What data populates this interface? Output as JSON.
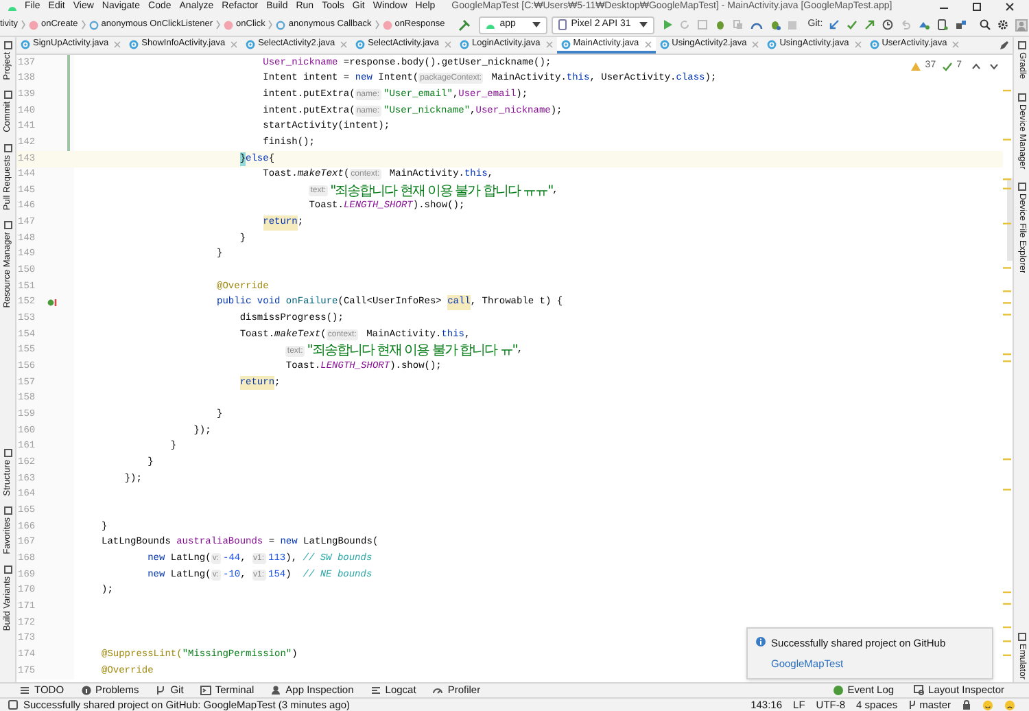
{
  "window": {
    "title": "GoogleMapTest [C:₩Users₩5-11₩Desktop₩GoogleMapTest] - MainActivity.java [GoogleMapTest.app]"
  },
  "menu": [
    "File",
    "Edit",
    "View",
    "Navigate",
    "Code",
    "Analyze",
    "Refactor",
    "Build",
    "Run",
    "Tools",
    "Git",
    "Window",
    "Help"
  ],
  "breadcrumbs": [
    {
      "label": "tivity",
      "kind": "plain"
    },
    {
      "label": "onCreate",
      "kind": "method"
    },
    {
      "label": "anonymous OnClickListener",
      "kind": "anonymous"
    },
    {
      "label": "onClick",
      "kind": "method"
    },
    {
      "label": "anonymous Callback",
      "kind": "anonymous"
    },
    {
      "label": "onResponse",
      "kind": "method"
    }
  ],
  "run_config": "app",
  "device": "Pixel 2 API 31",
  "git_label": "Git:",
  "left_tools": [
    "Project",
    "Commit",
    "Pull Requests",
    "Resource Manager",
    "Structure",
    "Favorites",
    "Build Variants"
  ],
  "right_tools": [
    "Gradle",
    "Device Manager",
    "Device File Explorer",
    "Emulator"
  ],
  "tabs": [
    {
      "label": "SignUpActivity.java",
      "selected": false
    },
    {
      "label": "ShowInfoActivity.java",
      "selected": false
    },
    {
      "label": "SelectActivity2.java",
      "selected": false
    },
    {
      "label": "SelectActivity.java",
      "selected": false
    },
    {
      "label": "LoginActivity.java",
      "selected": false
    },
    {
      "label": "MainActivity.java",
      "selected": true
    },
    {
      "label": "UsingActivity2.java",
      "selected": false
    },
    {
      "label": "UsingActivity.java",
      "selected": false
    },
    {
      "label": "UserActivity.java",
      "selected": false
    }
  ],
  "inspections": {
    "warnings": "37",
    "weak_warnings": "7"
  },
  "lines": [
    {
      "number": "137",
      "current": false,
      "modified": true,
      "overrides": false,
      "tokens": [
        {
          "kind": "field",
          "text": "                            User_nickname"
        },
        {
          "kind": "plain",
          "text": " =response.body().getUser_nickname();"
        }
      ]
    },
    {
      "number": "138",
      "current": false,
      "modified": true,
      "overrides": false,
      "tokens": [
        {
          "kind": "plain",
          "text": "                            Intent intent = "
        },
        {
          "kind": "kw",
          "text": "new"
        },
        {
          "kind": "plain",
          "text": " Intent("
        },
        {
          "kind": "hint",
          "text": "packageContext:"
        },
        {
          "kind": "plain",
          "text": " MainActivity."
        },
        {
          "kind": "kw",
          "text": "this"
        },
        {
          "kind": "plain",
          "text": ", UserActivity."
        },
        {
          "kind": "kw",
          "text": "class"
        },
        {
          "kind": "plain",
          "text": ");"
        }
      ]
    },
    {
      "number": "139",
      "current": false,
      "modified": true,
      "overrides": false,
      "tokens": [
        {
          "kind": "plain",
          "text": "                            intent.putExtra("
        },
        {
          "kind": "hint",
          "text": "name:"
        },
        {
          "kind": "str",
          "text": "\"User_email\""
        },
        {
          "kind": "plain",
          "text": ","
        },
        {
          "kind": "field",
          "text": "User_email"
        },
        {
          "kind": "plain",
          "text": ");"
        }
      ]
    },
    {
      "number": "140",
      "current": false,
      "modified": true,
      "overrides": false,
      "tokens": [
        {
          "kind": "plain",
          "text": "                            intent.putExtra("
        },
        {
          "kind": "hint",
          "text": "name:"
        },
        {
          "kind": "str",
          "text": "\"User_nickname\""
        },
        {
          "kind": "plain",
          "text": ","
        },
        {
          "kind": "field",
          "text": "User_nickname"
        },
        {
          "kind": "plain",
          "text": ");"
        }
      ]
    },
    {
      "number": "141",
      "current": false,
      "modified": true,
      "overrides": false,
      "tokens": [
        {
          "kind": "plain",
          "text": "                            startActivity(intent);"
        }
      ]
    },
    {
      "number": "142",
      "current": false,
      "modified": true,
      "overrides": false,
      "tokens": [
        {
          "kind": "plain",
          "text": "                            finish();"
        }
      ]
    },
    {
      "number": "143",
      "current": true,
      "modified": false,
      "overrides": false,
      "tokens": [
        {
          "kind": "brace",
          "text": "                        }"
        },
        {
          "kind": "kw",
          "text": "else"
        },
        {
          "kind": "plain",
          "text": "{"
        }
      ]
    },
    {
      "number": "144",
      "current": false,
      "modified": false,
      "overrides": false,
      "tokens": [
        {
          "kind": "plain",
          "text": "                            Toast."
        },
        {
          "kind": "method",
          "text": "makeText"
        },
        {
          "kind": "plain",
          "text": "("
        },
        {
          "kind": "hint",
          "text": "context:"
        },
        {
          "kind": "plain",
          "text": " MainActivity."
        },
        {
          "kind": "kw",
          "text": "this"
        },
        {
          "kind": "plain",
          "text": ","
        }
      ]
    },
    {
      "number": "145",
      "current": false,
      "modified": false,
      "overrides": false,
      "tokens": [
        {
          "kind": "hint",
          "text": "                                    text:"
        },
        {
          "kind": "str",
          "text": "\"죄송합니다 현재 이용 불가 합니다 ㅠㅠ\""
        },
        {
          "kind": "plain",
          "text": ","
        }
      ]
    },
    {
      "number": "146",
      "current": false,
      "modified": false,
      "overrides": false,
      "tokens": [
        {
          "kind": "plain",
          "text": "                                    Toast."
        },
        {
          "kind": "static",
          "text": "LENGTH_SHORT"
        },
        {
          "kind": "plain",
          "text": ").show();"
        }
      ]
    },
    {
      "number": "147",
      "current": false,
      "modified": false,
      "overrides": false,
      "tokens": [
        {
          "kind": "usage",
          "text": "                            return"
        },
        {
          "kind": "plain",
          "text": ";"
        }
      ]
    },
    {
      "number": "148",
      "current": false,
      "modified": false,
      "overrides": false,
      "tokens": [
        {
          "kind": "plain",
          "text": "                        }"
        }
      ]
    },
    {
      "number": "149",
      "current": false,
      "modified": false,
      "overrides": false,
      "tokens": [
        {
          "kind": "plain",
          "text": "                    }"
        }
      ]
    },
    {
      "number": "150",
      "current": false,
      "modified": false,
      "overrides": false
    },
    {
      "number": "151",
      "current": false,
      "modified": false,
      "overrides": false,
      "tokens": [
        {
          "kind": "annot",
          "text": "                    @Override"
        }
      ]
    },
    {
      "number": "152",
      "current": false,
      "modified": false,
      "overrides": true,
      "tokens": [
        {
          "kind": "kw",
          "text": "                    public void"
        },
        {
          "kind": "decl",
          "text": " onFailure"
        },
        {
          "kind": "plain",
          "text": "(Call<UserInfoRes> "
        },
        {
          "kind": "usage",
          "text": "call"
        },
        {
          "kind": "plain",
          "text": ", Throwable t) {"
        }
      ]
    },
    {
      "number": "153",
      "current": false,
      "modified": false,
      "overrides": false,
      "tokens": [
        {
          "kind": "plain",
          "text": "                        dismissProgress();"
        }
      ]
    },
    {
      "number": "154",
      "current": false,
      "modified": false,
      "overrides": false,
      "tokens": [
        {
          "kind": "plain",
          "text": "                        Toast."
        },
        {
          "kind": "method",
          "text": "makeText"
        },
        {
          "kind": "plain",
          "text": "("
        },
        {
          "kind": "hint",
          "text": "context:"
        },
        {
          "kind": "plain",
          "text": " MainActivity."
        },
        {
          "kind": "kw",
          "text": "this"
        },
        {
          "kind": "plain",
          "text": ","
        }
      ]
    },
    {
      "number": "155",
      "current": false,
      "modified": false,
      "overrides": false,
      "tokens": [
        {
          "kind": "hint",
          "text": "                                text:"
        },
        {
          "kind": "str",
          "text": "\"죄송합니다 현재 이용 불가 합니다 ㅠ\""
        },
        {
          "kind": "plain",
          "text": ","
        }
      ]
    },
    {
      "number": "156",
      "current": false,
      "modified": false,
      "overrides": false,
      "tokens": [
        {
          "kind": "plain",
          "text": "                                Toast."
        },
        {
          "kind": "static",
          "text": "LENGTH_SHORT"
        },
        {
          "kind": "plain",
          "text": ").show();"
        }
      ]
    },
    {
      "number": "157",
      "current": false,
      "modified": false,
      "overrides": false,
      "tokens": [
        {
          "kind": "usage",
          "text": "                        return"
        },
        {
          "kind": "plain",
          "text": ";"
        }
      ]
    },
    {
      "number": "158",
      "current": false,
      "modified": false,
      "overrides": false
    },
    {
      "number": "159",
      "current": false,
      "modified": false,
      "overrides": false,
      "tokens": [
        {
          "kind": "plain",
          "text": "                    }"
        }
      ]
    },
    {
      "number": "160",
      "current": false,
      "modified": false,
      "overrides": false,
      "tokens": [
        {
          "kind": "plain",
          "text": "                });"
        }
      ]
    },
    {
      "number": "161",
      "current": false,
      "modified": false,
      "overrides": false,
      "tokens": [
        {
          "kind": "plain",
          "text": "            }"
        }
      ]
    },
    {
      "number": "162",
      "current": false,
      "modified": false,
      "overrides": false,
      "tokens": [
        {
          "kind": "plain",
          "text": "        }"
        }
      ]
    },
    {
      "number": "163",
      "current": false,
      "modified": false,
      "overrides": false,
      "tokens": [
        {
          "kind": "plain",
          "text": "    });"
        }
      ]
    },
    {
      "number": "164",
      "current": false,
      "modified": false,
      "overrides": false
    },
    {
      "number": "165",
      "current": false,
      "modified": false,
      "overrides": false
    },
    {
      "number": "166",
      "current": false,
      "modified": false,
      "overrides": false,
      "tokens": [
        {
          "kind": "plain",
          "text": "}"
        }
      ]
    },
    {
      "number": "167",
      "current": false,
      "modified": false,
      "overrides": false,
      "tokens": [
        {
          "kind": "plain",
          "text": "LatLngBounds "
        },
        {
          "kind": "field",
          "text": "australiaBounds"
        },
        {
          "kind": "plain",
          "text": " = "
        },
        {
          "kind": "kw",
          "text": "new"
        },
        {
          "kind": "plain",
          "text": " LatLngBounds("
        }
      ]
    },
    {
      "number": "168",
      "current": false,
      "modified": false,
      "overrides": false,
      "tokens": [
        {
          "kind": "kw",
          "text": "        new"
        },
        {
          "kind": "plain",
          "text": " LatLng("
        },
        {
          "kind": "hint",
          "text": "v:"
        },
        {
          "kind": "num",
          "text": "-44"
        },
        {
          "kind": "plain",
          "text": ", "
        },
        {
          "kind": "hint",
          "text": "v1:"
        },
        {
          "kind": "num",
          "text": "113"
        },
        {
          "kind": "plain",
          "text": "), "
        },
        {
          "kind": "comment",
          "text": "// SW bounds"
        }
      ]
    },
    {
      "number": "169",
      "current": false,
      "modified": false,
      "overrides": false,
      "tokens": [
        {
          "kind": "kw",
          "text": "        new"
        },
        {
          "kind": "plain",
          "text": " LatLng("
        },
        {
          "kind": "hint",
          "text": "v:"
        },
        {
          "kind": "num",
          "text": "-10"
        },
        {
          "kind": "plain",
          "text": ", "
        },
        {
          "kind": "hint",
          "text": "v1:"
        },
        {
          "kind": "num",
          "text": "154"
        },
        {
          "kind": "plain",
          "text": ")  "
        },
        {
          "kind": "comment",
          "text": "// NE bounds"
        }
      ]
    },
    {
      "number": "170",
      "current": false,
      "modified": false,
      "overrides": false,
      "tokens": [
        {
          "kind": "plain",
          "text": ");"
        }
      ]
    },
    {
      "number": "171",
      "current": false,
      "modified": false,
      "overrides": false
    },
    {
      "number": "172",
      "current": false,
      "modified": false,
      "overrides": false
    },
    {
      "number": "173",
      "current": false,
      "modified": false,
      "overrides": false
    },
    {
      "number": "174",
      "current": false,
      "modified": false,
      "overrides": false,
      "tokens": [
        {
          "kind": "annot",
          "text": "@SuppressLint("
        },
        {
          "kind": "str",
          "text": "\"MissingPermission\""
        },
        {
          "kind": "plain",
          "text": ")"
        }
      ]
    },
    {
      "number": "175",
      "current": false,
      "modified": false,
      "overrides": false,
      "tokens": [
        {
          "kind": "annot",
          "text": "@Override"
        }
      ]
    }
  ],
  "notification": {
    "title": "Successfully shared project on GitHub",
    "link": "GoogleMapTest"
  },
  "bottom_tools": [
    {
      "label": "TODO",
      "kind": "list"
    },
    {
      "label": "Problems",
      "kind": "info"
    },
    {
      "label": "Git",
      "kind": "branch"
    },
    {
      "label": "Terminal",
      "kind": "terminal"
    },
    {
      "label": "App Inspection",
      "kind": "inspect"
    },
    {
      "label": "Logcat",
      "kind": "log"
    },
    {
      "label": "Profiler",
      "kind": "gauge"
    }
  ],
  "bottom_tools_right": [
    {
      "label": "Event Log",
      "kind": "event"
    },
    {
      "label": "Layout Inspector",
      "kind": "layout"
    }
  ],
  "status": {
    "message": "Successfully shared project on GitHub: GoogleMapTest (3 minutes ago)",
    "position": "143:16",
    "line_separator": "LF",
    "encoding": "UTF-8",
    "indent": "4 spaces",
    "branch": "master"
  }
}
